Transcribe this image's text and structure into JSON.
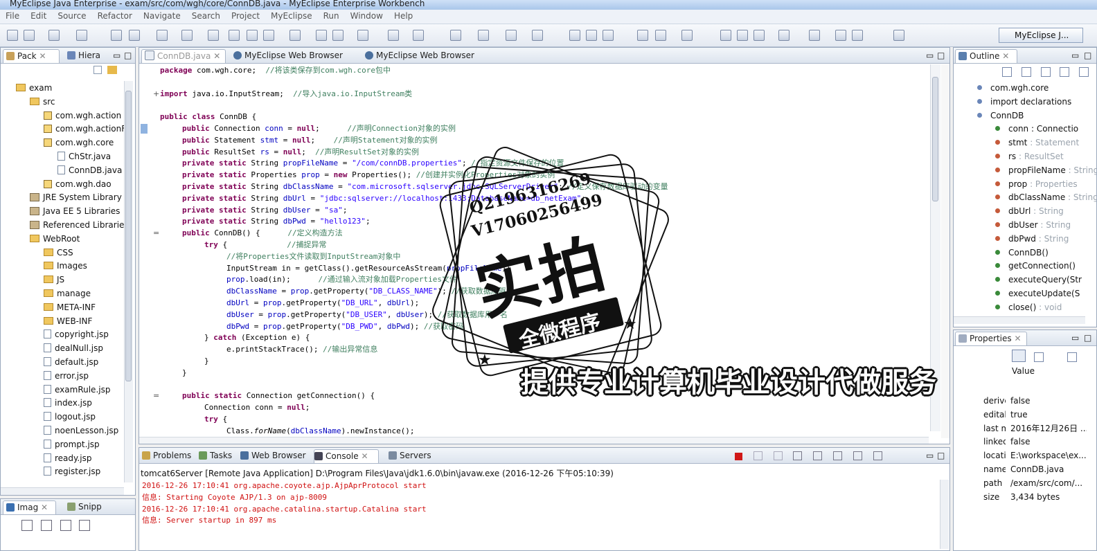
{
  "window": {
    "title": "MyEclipse Java Enterprise - exam/src/com/wgh/core/ConnDB.java - MyEclipse Enterprise Workbench"
  },
  "menu": [
    "File",
    "Edit",
    "Source",
    "Refactor",
    "Navigate",
    "Search",
    "Project",
    "MyEclipse",
    "Run",
    "Window",
    "Help"
  ],
  "perspective": "MyEclipse J...",
  "left_panel": {
    "tabs": [
      "Pack",
      "Hiera"
    ],
    "tree": [
      {
        "label": "exam",
        "type": "project",
        "indent": 0
      },
      {
        "label": "src",
        "type": "folder",
        "indent": 1
      },
      {
        "label": "com.wgh.action",
        "type": "pkg",
        "indent": 2
      },
      {
        "label": "com.wgh.actionF",
        "type": "pkg",
        "indent": 2
      },
      {
        "label": "com.wgh.core",
        "type": "pkg",
        "indent": 2
      },
      {
        "label": "ChStr.java",
        "type": "java",
        "indent": 3
      },
      {
        "label": "ConnDB.java",
        "type": "java",
        "indent": 3
      },
      {
        "label": "com.wgh.dao",
        "type": "pkg",
        "indent": 2
      },
      {
        "label": "JRE System Library",
        "type": "lib",
        "indent": 1
      },
      {
        "label": "Java EE 5 Libraries",
        "type": "lib",
        "indent": 1
      },
      {
        "label": "Referenced Librarie",
        "type": "lib",
        "indent": 1
      },
      {
        "label": "WebRoot",
        "type": "folder",
        "indent": 1
      },
      {
        "label": "CSS",
        "type": "folder",
        "indent": 2
      },
      {
        "label": "Images",
        "type": "folder",
        "indent": 2
      },
      {
        "label": "JS",
        "type": "folder",
        "indent": 2
      },
      {
        "label": "manage",
        "type": "folder",
        "indent": 2
      },
      {
        "label": "META-INF",
        "type": "folder",
        "indent": 2
      },
      {
        "label": "WEB-INF",
        "type": "folder",
        "indent": 2
      },
      {
        "label": "copyright.jsp",
        "type": "jsp",
        "indent": 2
      },
      {
        "label": "dealNull.jsp",
        "type": "jsp",
        "indent": 2
      },
      {
        "label": "default.jsp",
        "type": "jsp",
        "indent": 2
      },
      {
        "label": "error.jsp",
        "type": "jsp",
        "indent": 2
      },
      {
        "label": "examRule.jsp",
        "type": "jsp",
        "indent": 2
      },
      {
        "label": "index.jsp",
        "type": "jsp",
        "indent": 2
      },
      {
        "label": "logout.jsp",
        "type": "jsp",
        "indent": 2
      },
      {
        "label": "noenLesson.jsp",
        "type": "jsp",
        "indent": 2
      },
      {
        "label": "prompt.jsp",
        "type": "jsp",
        "indent": 2
      },
      {
        "label": "ready.jsp",
        "type": "jsp",
        "indent": 2
      },
      {
        "label": "register.jsp",
        "type": "jsp",
        "indent": 2
      }
    ]
  },
  "left_bottom": {
    "tabs": [
      "Imag",
      "Snipp"
    ]
  },
  "editor": {
    "tabs": [
      "ConnDB.java",
      "MyEclipse Web Browser",
      "MyEclipse Web Browser"
    ],
    "lines": [
      {
        "indent": 0,
        "parts": [
          [
            "kw",
            "package"
          ],
          [
            "t",
            " com.wgh.core;  "
          ],
          [
            "cmt",
            "//将该类保存到com.wgh.core包中"
          ]
        ]
      },
      {
        "indent": 0,
        "parts": []
      },
      {
        "indent": 0,
        "marker": "+",
        "parts": [
          [
            "kw",
            "import"
          ],
          [
            "t",
            " java.io.InputStream;  "
          ],
          [
            "cmt",
            "//导入java.io.InputStream类"
          ]
        ]
      },
      {
        "indent": 0,
        "parts": []
      },
      {
        "indent": 0,
        "parts": [
          [
            "kw",
            "public class"
          ],
          [
            "t",
            " ConnDB {"
          ]
        ]
      },
      {
        "indent": 1,
        "parts": [
          [
            "kw",
            "public"
          ],
          [
            "t",
            " Connection "
          ],
          [
            "fld",
            "conn"
          ],
          [
            "t",
            " = "
          ],
          [
            "kw",
            "null"
          ],
          [
            "t",
            ";      "
          ],
          [
            "cmt",
            "//声明Connection对象的实例"
          ]
        ]
      },
      {
        "indent": 1,
        "parts": [
          [
            "kw",
            "public"
          ],
          [
            "t",
            " Statement "
          ],
          [
            "fld",
            "stmt"
          ],
          [
            "t",
            " = "
          ],
          [
            "kw",
            "null"
          ],
          [
            "t",
            ";    "
          ],
          [
            "cmt",
            "//声明Statement对象的实例"
          ]
        ]
      },
      {
        "indent": 1,
        "parts": [
          [
            "kw",
            "public"
          ],
          [
            "t",
            " ResultSet "
          ],
          [
            "fld",
            "rs"
          ],
          [
            "t",
            " = "
          ],
          [
            "kw",
            "null"
          ],
          [
            "t",
            ";  "
          ],
          [
            "cmt",
            "//声明ResultSet对象的实例"
          ]
        ]
      },
      {
        "indent": 1,
        "parts": [
          [
            "kw",
            "private static"
          ],
          [
            "t",
            " String "
          ],
          [
            "fld",
            "propFileName"
          ],
          [
            "t",
            " = "
          ],
          [
            "str",
            "\"/com/connDB.properties\""
          ],
          [
            "t",
            "; "
          ],
          [
            "cmt",
            "//指定资源文件保存的位置"
          ]
        ]
      },
      {
        "indent": 1,
        "parts": [
          [
            "kw",
            "private static"
          ],
          [
            "t",
            " Properties "
          ],
          [
            "fld",
            "prop"
          ],
          [
            "t",
            " = "
          ],
          [
            "kw",
            "new"
          ],
          [
            "t",
            " Properties(); "
          ],
          [
            "cmt",
            "//创建并实例化Properties对象的实例"
          ]
        ]
      },
      {
        "indent": 1,
        "parts": [
          [
            "kw",
            "private static"
          ],
          [
            "t",
            " String "
          ],
          [
            "fld",
            "dbClassName"
          ],
          [
            "t",
            " = "
          ],
          [
            "str",
            "\"com.microsoft.sqlserver.jdbc.SQLServerDriver\""
          ],
          [
            "t",
            "; "
          ],
          [
            "cmt",
            "//定义保存数据库驱动的变量"
          ]
        ]
      },
      {
        "indent": 1,
        "parts": [
          [
            "kw",
            "private static"
          ],
          [
            "t",
            " String "
          ],
          [
            "fld",
            "dbUrl"
          ],
          [
            "t",
            " = "
          ],
          [
            "str",
            "\"jdbc:sqlserver://localhost:1433;DatabaseName=db_netExam\""
          ],
          [
            "t",
            ";"
          ]
        ]
      },
      {
        "indent": 1,
        "parts": [
          [
            "kw",
            "private static"
          ],
          [
            "t",
            " String "
          ],
          [
            "fld",
            "dbUser"
          ],
          [
            "t",
            " = "
          ],
          [
            "str",
            "\"sa\""
          ],
          [
            "t",
            ";"
          ]
        ]
      },
      {
        "indent": 1,
        "parts": [
          [
            "kw",
            "private static"
          ],
          [
            "t",
            " String "
          ],
          [
            "fld",
            "dbPwd"
          ],
          [
            "t",
            " = "
          ],
          [
            "str",
            "\"hello123\""
          ],
          [
            "t",
            ";"
          ]
        ]
      },
      {
        "indent": 1,
        "marker": "=",
        "parts": [
          [
            "kw",
            "public"
          ],
          [
            "t",
            " ConnDB() {      "
          ],
          [
            "cmt",
            "//定义构造方法"
          ]
        ]
      },
      {
        "indent": 2,
        "parts": [
          [
            "kw",
            "try"
          ],
          [
            "t",
            " {             "
          ],
          [
            "cmt",
            "//捕捉异常"
          ]
        ]
      },
      {
        "indent": 3,
        "parts": [
          [
            "cmt",
            "//将Properties文件读取到InputStream对象中"
          ]
        ]
      },
      {
        "indent": 3,
        "parts": [
          [
            "t",
            "InputStream in = getClass().getResourceAsStream("
          ],
          [
            "fld",
            "propFileName"
          ],
          [
            "t",
            ");"
          ]
        ]
      },
      {
        "indent": 3,
        "parts": [
          [
            "fld",
            "prop"
          ],
          [
            "t",
            ".load(in);      "
          ],
          [
            "cmt",
            "//通过输入流对象加载Properties文件"
          ]
        ]
      },
      {
        "indent": 3,
        "parts": [
          [
            "fld",
            "dbClassName"
          ],
          [
            "t",
            " = "
          ],
          [
            "fld",
            "prop"
          ],
          [
            "t",
            ".getProperty("
          ],
          [
            "str",
            "\"DB_CLASS_NAME\""
          ],
          [
            "t",
            "); "
          ],
          [
            "cmt",
            "//获取数据库驱动"
          ]
        ]
      },
      {
        "indent": 3,
        "parts": [
          [
            "fld",
            "dbUrl"
          ],
          [
            "t",
            " = "
          ],
          [
            "fld",
            "prop"
          ],
          [
            "t",
            ".getProperty("
          ],
          [
            "str",
            "\"DB_URL\""
          ],
          [
            "t",
            ", "
          ],
          [
            "fld",
            "dbUrl"
          ],
          [
            "t",
            ");"
          ]
        ]
      },
      {
        "indent": 3,
        "parts": [
          [
            "fld",
            "dbUser"
          ],
          [
            "t",
            " = "
          ],
          [
            "fld",
            "prop"
          ],
          [
            "t",
            ".getProperty("
          ],
          [
            "str",
            "\"DB_USER\""
          ],
          [
            "t",
            ", "
          ],
          [
            "fld",
            "dbUser"
          ],
          [
            "t",
            "); "
          ],
          [
            "cmt",
            "//获取数据库用户名"
          ]
        ]
      },
      {
        "indent": 3,
        "parts": [
          [
            "fld",
            "dbPwd"
          ],
          [
            "t",
            " = "
          ],
          [
            "fld",
            "prop"
          ],
          [
            "t",
            ".getProperty("
          ],
          [
            "str",
            "\"DB_PWD\""
          ],
          [
            "t",
            ", "
          ],
          [
            "fld",
            "dbPwd"
          ],
          [
            "t",
            "); "
          ],
          [
            "cmt",
            "//获取密码"
          ]
        ]
      },
      {
        "indent": 2,
        "parts": [
          [
            "t",
            "} "
          ],
          [
            "kw",
            "catch"
          ],
          [
            "t",
            " (Exception e) {"
          ]
        ]
      },
      {
        "indent": 3,
        "parts": [
          [
            "t",
            "e.printStackTrace(); "
          ],
          [
            "cmt",
            "//输出异常信息"
          ]
        ]
      },
      {
        "indent": 2,
        "parts": [
          [
            "t",
            "}"
          ]
        ]
      },
      {
        "indent": 1,
        "parts": [
          [
            "t",
            "}"
          ]
        ]
      },
      {
        "indent": 0,
        "parts": []
      },
      {
        "indent": 1,
        "marker": "=",
        "parts": [
          [
            "kw",
            "public static"
          ],
          [
            "t",
            " Connection getConnection() {"
          ]
        ]
      },
      {
        "indent": 2,
        "parts": [
          [
            "t",
            "Connection conn = "
          ],
          [
            "kw",
            "null"
          ],
          [
            "t",
            ";"
          ]
        ]
      },
      {
        "indent": 2,
        "parts": [
          [
            "kw",
            "try"
          ],
          [
            "t",
            " {"
          ]
        ]
      },
      {
        "indent": 3,
        "parts": [
          [
            "t",
            "Class."
          ],
          [
            "i",
            "forName"
          ],
          [
            "t",
            "("
          ],
          [
            "fld",
            "dbClassName"
          ],
          [
            "t",
            ").newInstance();"
          ]
        ]
      }
    ]
  },
  "outline": {
    "tab": "Outline",
    "items": [
      {
        "name": "com.wgh.core",
        "type": ""
      },
      {
        "name": "import declarations",
        "type": ""
      },
      {
        "name": "ConnDB",
        "type": ""
      },
      {
        "name": "conn : Connectio",
        "type": ""
      },
      {
        "name": "stmt",
        "type": ": Statement"
      },
      {
        "name": "rs",
        "type": ": ResultSet"
      },
      {
        "name": "propFileName",
        "type": ": String"
      },
      {
        "name": "prop",
        "type": ": Properties"
      },
      {
        "name": "dbClassName",
        "type": ": String"
      },
      {
        "name": "dbUrl",
        "type": ": String"
      },
      {
        "name": "dbUser",
        "type": ": String"
      },
      {
        "name": "dbPwd",
        "type": ": String"
      },
      {
        "name": "ConnDB()",
        "type": ""
      },
      {
        "name": "getConnection()",
        "type": ""
      },
      {
        "name": "executeQuery(Str",
        "type": ""
      },
      {
        "name": "executeUpdate(S",
        "type": ""
      },
      {
        "name": "close()",
        "type": ": void"
      }
    ]
  },
  "properties": {
    "tab": "Properties",
    "value_header": "Value",
    "rows": [
      {
        "k": "derive",
        "v": "false"
      },
      {
        "k": "edital",
        "v": "true"
      },
      {
        "k": "last m",
        "v": "2016年12月26日 ..."
      },
      {
        "k": "linked",
        "v": "false"
      },
      {
        "k": "locati",
        "v": "E:\\workspace\\ex..."
      },
      {
        "k": "name",
        "v": "ConnDB.java"
      },
      {
        "k": "path",
        "v": "/exam/src/com/..."
      },
      {
        "k": "size",
        "v": "3,434  bytes"
      }
    ]
  },
  "console": {
    "tabs": [
      "Problems",
      "Tasks",
      "Web Browser",
      "Console",
      "Servers"
    ],
    "header": "tomcat6Server [Remote Java Application] D:\\Program Files\\Java\\jdk1.6.0\\bin\\javaw.exe (2016-12-26 下午05:10:39)",
    "lines": [
      "2016-12-26 17:10:41 org.apache.coyote.ajp.AjpAprProtocol start",
      "信息: Starting Coyote AJP/1.3 on ajp-8009",
      "2016-12-26 17:10:41 org.apache.catalina.startup.Catalina start",
      "信息: Server startup in 897 ms"
    ]
  },
  "watermark": {
    "qq": "Q2196316269",
    "wx": "V17060256499",
    "big": "实拍",
    "ribbon": "全微程序",
    "slogan": "提供专业计算机毕业设计代做服务"
  }
}
